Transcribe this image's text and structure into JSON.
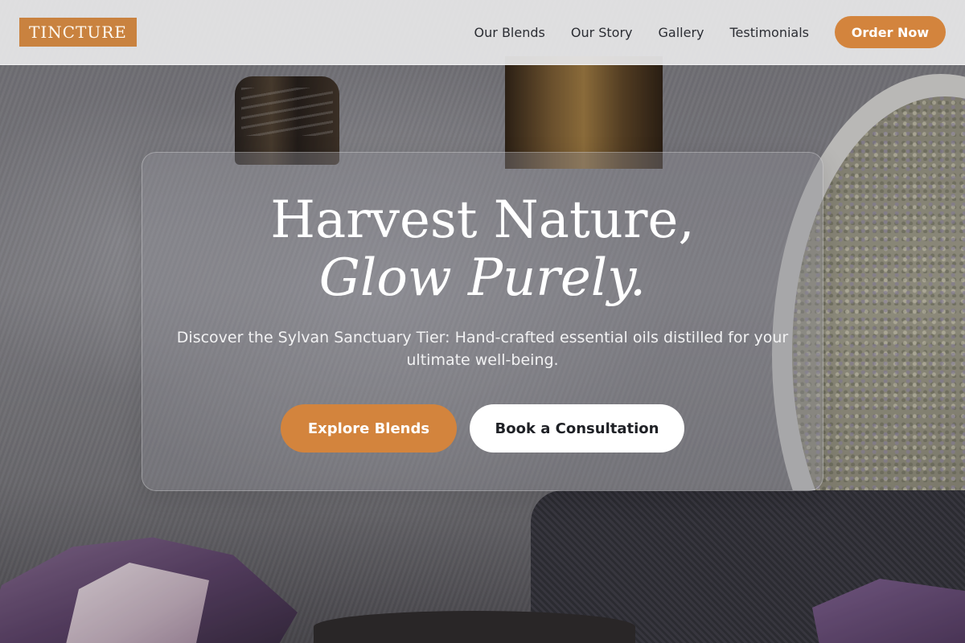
{
  "brand": {
    "logo_text": "TINCTURE",
    "accent_color": "#d3843d"
  },
  "nav": {
    "links": [
      "Our Blends",
      "Our Story",
      "Gallery",
      "Testimonials"
    ],
    "cta_label": "Order Now"
  },
  "hero": {
    "title_line1": "Harvest Nature,",
    "title_line2": "Glow Purely.",
    "subtitle": "Discover the Sylvan Sanctuary Tier: Hand-crafted essential oils distilled for your ultimate well-being.",
    "primary_button": "Explore Blends",
    "secondary_button": "Book a Consultation",
    "background_description_icon": "aromatherapy-photo"
  }
}
